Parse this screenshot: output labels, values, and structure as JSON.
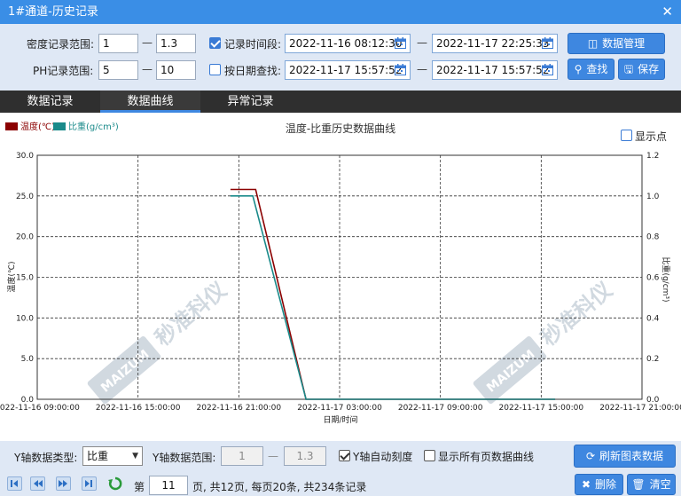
{
  "window": {
    "title": "1#通道-历史记录",
    "close_symbol": "✕"
  },
  "filters": {
    "density_label": "密度记录范围:",
    "density_min": "1",
    "density_max": "1.3",
    "ph_label": "PH记录范围:",
    "ph_min": "5",
    "ph_max": "10",
    "range_sep": "—",
    "time_checkbox_label": "记录时间段:",
    "time_checked": true,
    "time_start": "2022-11-16 08:12:30",
    "time_end": "2022-11-17 22:25:33",
    "date_checkbox_label": "按日期查找:",
    "date_checked": false,
    "date_start": "2022-11-17 15:57:52",
    "date_end": "2022-11-17 15:57:52"
  },
  "buttons": {
    "data_manage": "数据管理",
    "search": "查找",
    "save": "保存",
    "refresh": "刷新图表数据",
    "delete": "删除",
    "clear": "清空"
  },
  "tabs": [
    {
      "label": "数据记录"
    },
    {
      "label": "数据曲线"
    },
    {
      "label": "异常记录"
    }
  ],
  "active_tab": 1,
  "chart_data": {
    "type": "line",
    "title": "温度-比重历史数据曲线",
    "xlabel": "日期/时间",
    "ylabel_left": "温度(℃)",
    "ylabel_right": "比重(g/cm³)",
    "show_points_label": "显示点",
    "show_points": false,
    "ylim_left": [
      0,
      30
    ],
    "yticks_left": [
      "0.0",
      "5.0",
      "10.0",
      "15.0",
      "20.0",
      "25.0",
      "30.0"
    ],
    "ylim_right": [
      0,
      1.2
    ],
    "yticks_right": [
      "0.0",
      "0.2",
      "0.4",
      "0.6",
      "0.8",
      "1.0",
      "1.2"
    ],
    "xlim": [
      "2022-11-16 09:00:00",
      "2022-11-17 21:00:00"
    ],
    "xticks": [
      "2022-11-16 09:00:00",
      "2022-11-16 15:00:00",
      "2022-11-16 21:00:00",
      "2022-11-17 03:00:00",
      "2022-11-17 09:00:00",
      "2022-11-17 15:00:00",
      "2022-11-17 21:00:00"
    ],
    "grid": true,
    "legend_position": "top-left",
    "series": [
      {
        "name": "温度(℃)",
        "axis": "left",
        "color": "#8b0000",
        "points": [
          [
            "2022-11-16 20:30:00",
            25.8
          ],
          [
            "2022-11-16 22:00:00",
            25.8
          ],
          [
            "2022-11-17 01:00:00",
            0
          ],
          [
            "2022-11-17 15:50:00",
            0
          ]
        ]
      },
      {
        "name": "比重(g/cm³)",
        "axis": "right",
        "color": "#1a8a8a",
        "points": [
          [
            "2022-11-16 20:30:00",
            1.0
          ],
          [
            "2022-11-16 21:50:00",
            1.0
          ],
          [
            "2022-11-17 01:00:00",
            0
          ],
          [
            "2022-11-17 15:50:00",
            0
          ]
        ]
      }
    ]
  },
  "watermark": {
    "brand": "MAIZUM",
    "text": "秒准科仪"
  },
  "bottom": {
    "y_type_label": "Y轴数据类型:",
    "y_type_value": "比重",
    "y_range_label": "Y轴数据范围:",
    "y_range_min": "1",
    "y_range_max": "1.3",
    "auto_scale_label": "Y轴自动刻度",
    "auto_scale_checked": true,
    "show_all_label": "显示所有页数据曲线",
    "show_all_checked": false,
    "page_prefix": "第",
    "page_value": "11",
    "page_info": "页, 共12页, 每页20条, 共234条记录"
  },
  "colors": {
    "titlebar": "#3a8ee6",
    "button": "#3e87e0",
    "tab_bg": "#2f2f2f",
    "window_bg": "#dfe8f5"
  }
}
